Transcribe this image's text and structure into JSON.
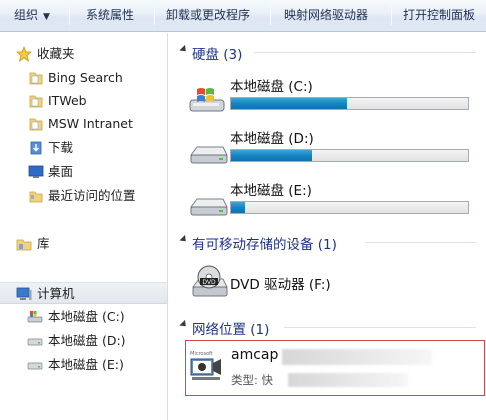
{
  "toolbar": {
    "organize": "组织",
    "system_properties": "系统属性",
    "uninstall": "卸载或更改程序",
    "map_network_drive": "映射网络驱动器",
    "open_control_panel": "打开控制面板"
  },
  "nav": {
    "favorites_header": "收藏夹",
    "favorites": [
      {
        "label": "Bing Search"
      },
      {
        "label": "ITWeb"
      },
      {
        "label": "MSW Intranet"
      },
      {
        "label": "下载"
      },
      {
        "label": "桌面"
      },
      {
        "label": "最近访问的位置"
      }
    ],
    "libraries": "库",
    "computer": "计算机",
    "drives": [
      {
        "label": "本地磁盘 (C:)"
      },
      {
        "label": "本地磁盘 (D:)"
      },
      {
        "label": "本地磁盘 (E:)"
      }
    ]
  },
  "content": {
    "hard_disks": {
      "title": "硬盘 (3)",
      "drives": [
        {
          "name": "本地磁盘 (C:)",
          "used_fraction": 0.49
        },
        {
          "name": "本地磁盘 (D:)",
          "used_fraction": 0.34
        },
        {
          "name": "本地磁盘 (E:)",
          "used_fraction": 0.06
        }
      ]
    },
    "removable": {
      "title": "有可移动存储的设备 (1)",
      "dvd": "DVD 驱动器 (F:)"
    },
    "network": {
      "title": "网络位置 (1)",
      "item_name": "amcap",
      "item_type": "类型: 快"
    }
  },
  "colors": {
    "accent": "#1e3287",
    "bar_fill": "#1585c4",
    "selection_border": "#d04848"
  }
}
